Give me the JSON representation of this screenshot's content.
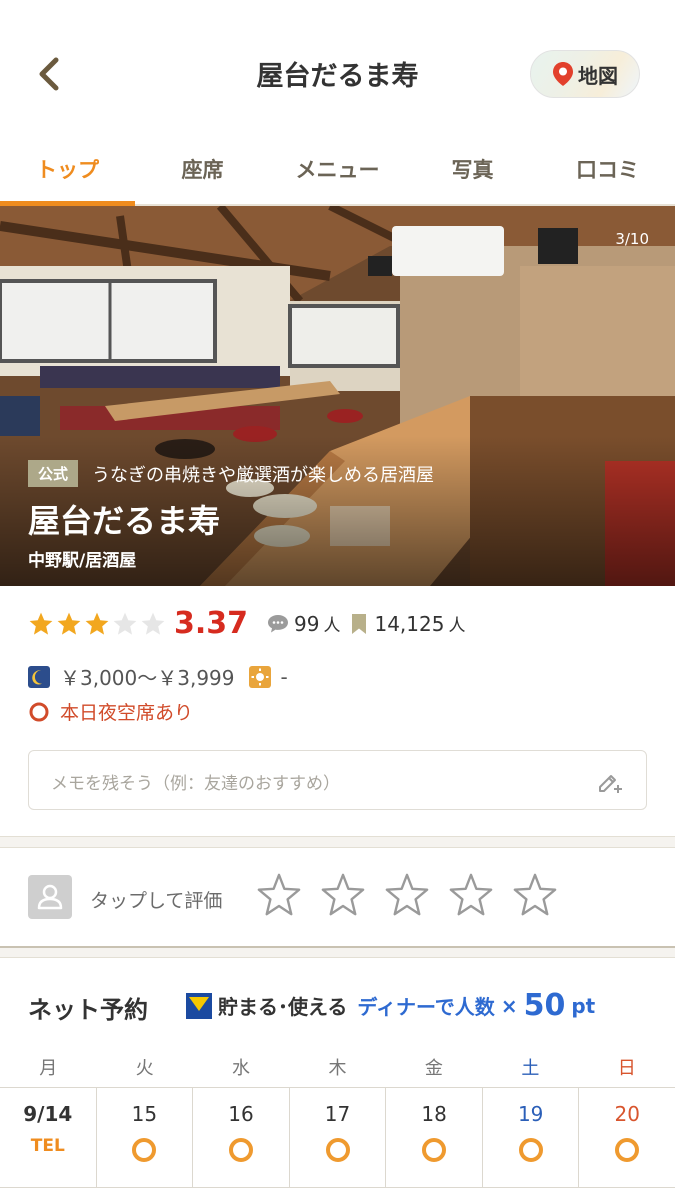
{
  "header": {
    "title": "屋台だるま寿",
    "map_label": "地図"
  },
  "tabs": [
    "トップ",
    "座席",
    "メニュー",
    "写真",
    "口コミ"
  ],
  "hero": {
    "counter": "3/10",
    "badge": "公式",
    "catch": "うなぎの串焼きや厳選酒が楽しめる居酒屋",
    "name": "屋台だるま寿",
    "area": "中野駅/居酒屋"
  },
  "rating": {
    "score": "3.37",
    "stars_filled": 3,
    "stars_total": 5,
    "reviews": "99",
    "reviews_unit": "人",
    "saves": "14,125",
    "saves_unit": "人"
  },
  "price": {
    "dinner": "￥3,000～￥3,999",
    "lunch": "-"
  },
  "availability": "本日夜空席あり",
  "memo": {
    "placeholder": "メモを残そう（例：友達のおすすめ）"
  },
  "rate": {
    "label": "タップして評価"
  },
  "net": {
    "title": "ネット予約",
    "promo_a": "貯まる･使える",
    "promo_b": "ディナーで人数",
    "promo_x": "×",
    "promo_pt": "50",
    "promo_unit": "pt"
  },
  "calendar": {
    "weekdays": [
      "月",
      "火",
      "水",
      "木",
      "金",
      "土",
      "日"
    ],
    "days": [
      "9/14",
      "15",
      "16",
      "17",
      "18",
      "19",
      "20"
    ],
    "first_status": "TEL"
  },
  "colors": {
    "accent": "#ef8c1f",
    "score": "#d62b1f",
    "saturday": "#2b5fb8",
    "sunday": "#d8552e"
  }
}
